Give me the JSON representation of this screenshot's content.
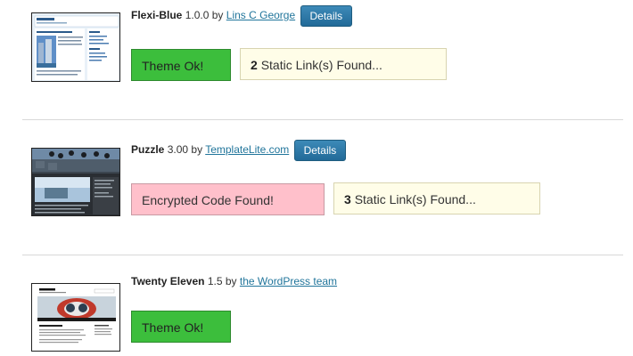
{
  "themes": [
    {
      "name": "Flexi-Blue",
      "version": "1.0.0",
      "by": "by",
      "author": "Lins C George",
      "details_label": "Details",
      "status_label": "Theme Ok!",
      "links_count": "2",
      "links_text": "Static Link(s) Found..."
    },
    {
      "name": "Puzzle",
      "version": "3.00",
      "by": "by",
      "author": "TemplateLite.com",
      "details_label": "Details",
      "status_label": "Encrypted Code Found!",
      "links_count": "3",
      "links_text": "Static Link(s) Found..."
    },
    {
      "name": "Twenty Eleven",
      "version": "1.5",
      "by": "by",
      "author": "the WordPress team",
      "status_label": "Theme Ok!"
    }
  ],
  "colors": {
    "ok": "#3cbe3c",
    "encrypted": "#ffc0cb",
    "links": "#fffde8",
    "link_text": "#21759b",
    "button": "#2b76a6"
  }
}
